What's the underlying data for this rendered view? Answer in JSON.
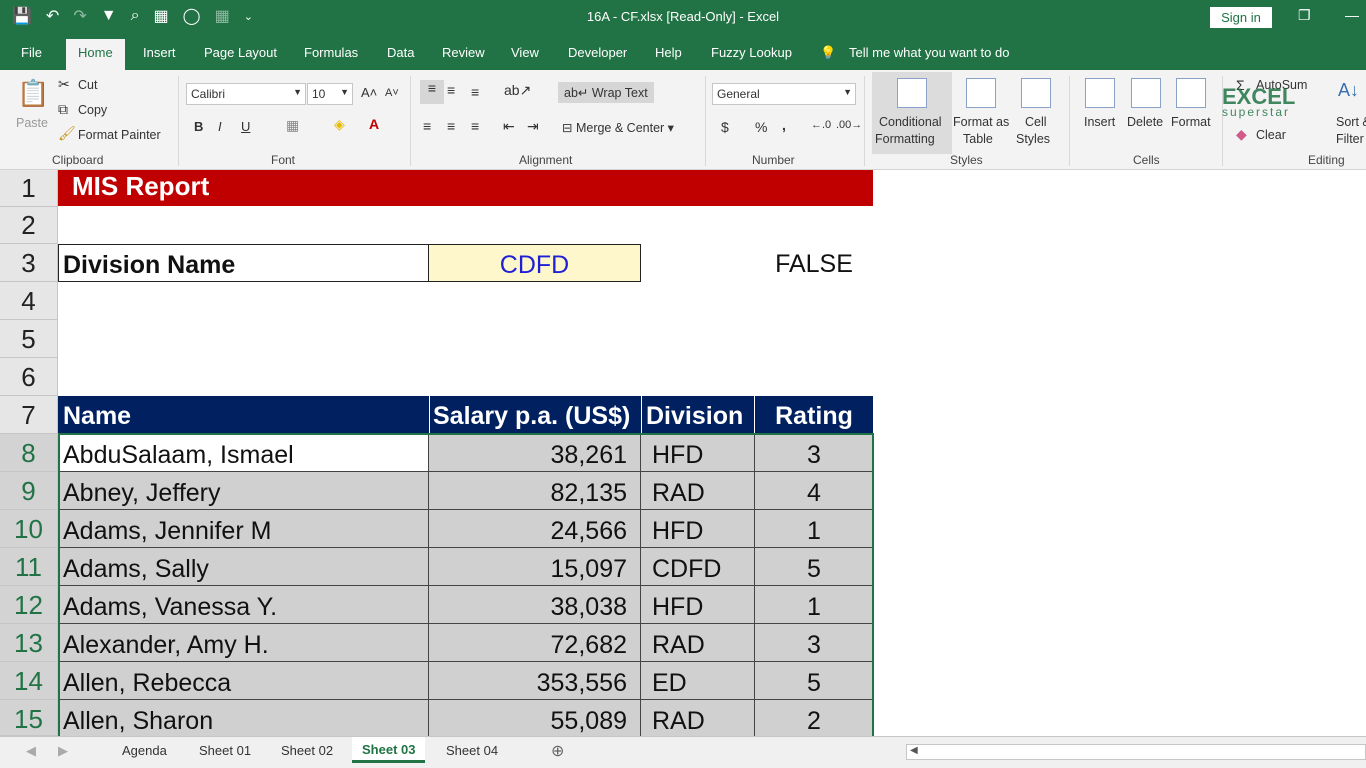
{
  "titlebar": {
    "qat": [
      "💾",
      "↶",
      "↷",
      "▼",
      "⌕",
      "▦",
      "◯",
      "▦",
      "⌄"
    ],
    "title": "16A - CF.xlsx  [Read-Only]  -  Excel",
    "signin": "Sign in",
    "restore": "❐",
    "minimize": "—"
  },
  "tabs": [
    "File",
    "Home",
    "Insert",
    "Page Layout",
    "Formulas",
    "Data",
    "Review",
    "View",
    "Developer",
    "Help",
    "Fuzzy Lookup"
  ],
  "tellme": "Tell me what you want to do",
  "ribbon": {
    "clipboard": {
      "label": "Clipboard",
      "paste": "Paste",
      "cut": "Cut",
      "copy": "Copy",
      "format_painter": "Format Painter"
    },
    "font": {
      "label": "Font",
      "name": "Calibri",
      "size": "10",
      "bold": "B",
      "italic": "I",
      "underline": "U"
    },
    "alignment": {
      "label": "Alignment",
      "wrap": "Wrap Text",
      "merge": "Merge & Center"
    },
    "number": {
      "label": "Number",
      "format": "General",
      "currency": "$",
      "percent": "%",
      "comma": ","
    },
    "styles": {
      "label": "Styles",
      "cf": "Conditional",
      "cf2": "Formatting",
      "fat": "Format as",
      "fat2": "Table",
      "cs": "Cell",
      "cs2": "Styles"
    },
    "cells": {
      "label": "Cells",
      "insert": "Insert",
      "delete": "Delete",
      "format": "Format"
    },
    "editing": {
      "label": "Editing",
      "autosum": "AutoSum",
      "clear": "Clear",
      "sort": "Sort &",
      "filter": "Filter"
    },
    "logo": "EXCEL",
    "logo_sub": "superstar"
  },
  "sheet": {
    "report_title": "MIS Report",
    "division_label": "Division Name",
    "division_value": "CDFD",
    "flag": "FALSE",
    "headers": [
      "Name",
      "Salary p.a. (US$)",
      "Division",
      "Rating"
    ],
    "row_numbers": [
      "1",
      "2",
      "3",
      "4",
      "5",
      "6",
      "7",
      "8",
      "9",
      "10",
      "11",
      "12",
      "13",
      "14",
      "15"
    ],
    "rows": [
      {
        "name": "AbduSalaam, Ismael",
        "salary": "38,261",
        "division": "HFD",
        "rating": "3"
      },
      {
        "name": "Abney, Jeffery",
        "salary": "82,135",
        "division": "RAD",
        "rating": "4"
      },
      {
        "name": "Adams, Jennifer M",
        "salary": "24,566",
        "division": "HFD",
        "rating": "1"
      },
      {
        "name": "Adams, Sally",
        "salary": "15,097",
        "division": "CDFD",
        "rating": "5"
      },
      {
        "name": "Adams, Vanessa Y.",
        "salary": "38,038",
        "division": "HFD",
        "rating": "1"
      },
      {
        "name": "Alexander, Amy H.",
        "salary": "72,682",
        "division": "RAD",
        "rating": "3"
      },
      {
        "name": "Allen, Rebecca",
        "salary": "353,556",
        "division": "ED",
        "rating": "5"
      },
      {
        "name": "Allen, Sharon",
        "salary": "55,089",
        "division": "RAD",
        "rating": "2"
      }
    ]
  },
  "sheet_tabs": [
    "Agenda",
    "Sheet 01",
    "Sheet 02",
    "Sheet 03",
    "Sheet 04"
  ],
  "active_sheet": "Sheet 03"
}
